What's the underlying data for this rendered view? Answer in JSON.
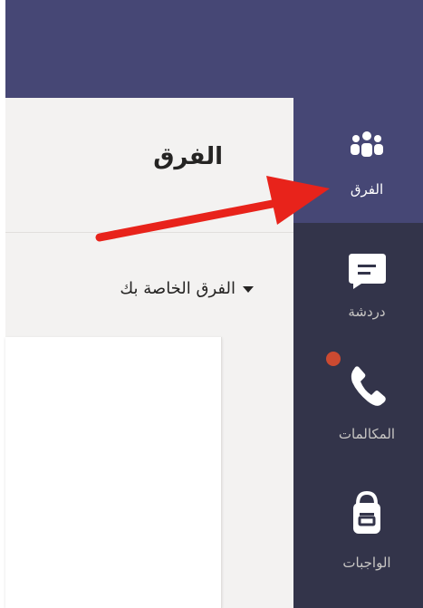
{
  "header": {
    "title": "الفرق"
  },
  "teams_section": {
    "label": "الفرق الخاصة بك"
  },
  "rail": {
    "items": [
      {
        "label": "الفرق",
        "icon": "teams-icon",
        "active": true
      },
      {
        "label": "دردشة",
        "icon": "chat-icon",
        "active": false
      },
      {
        "label": "المكالمات",
        "icon": "phone-icon",
        "active": false,
        "notification": true
      },
      {
        "label": "الواجبات",
        "icon": "assignments-icon",
        "active": false
      }
    ]
  },
  "colors": {
    "topbar": "#464775",
    "rail": "#33344a",
    "rail_active": "#464775",
    "main_background": "#f3f2f1",
    "arrow": "#e8231b",
    "notification_dot": "#cc4a31"
  }
}
